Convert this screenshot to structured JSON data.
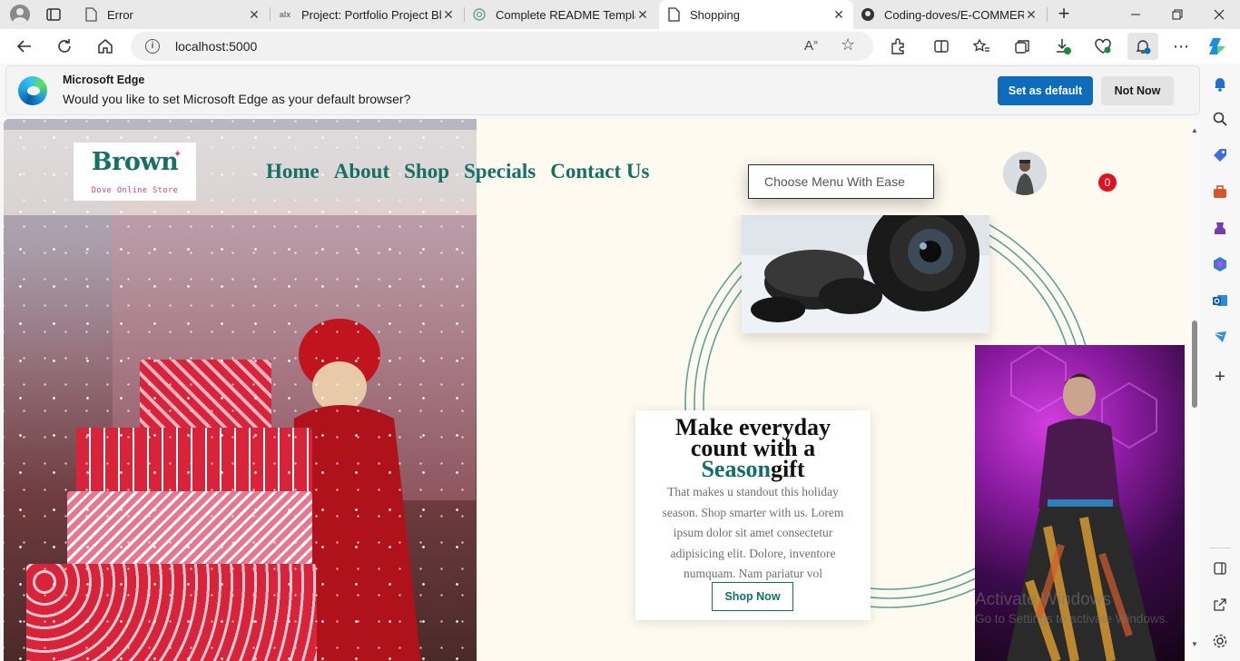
{
  "browser": {
    "tabs": [
      {
        "title": "Error",
        "favicon": "page-icon",
        "active": false
      },
      {
        "title": "Project: Portfolio Project Blo",
        "favicon": "alx-icon",
        "active": false
      },
      {
        "title": "Complete README Templat",
        "favicon": "openai-icon",
        "active": false
      },
      {
        "title": "Shopping",
        "favicon": "page-icon",
        "active": true
      },
      {
        "title": "Coding-doves/E-COMMERC",
        "favicon": "github-icon",
        "active": false
      }
    ],
    "url": "localhost:5000"
  },
  "infobar": {
    "title": "Microsoft Edge",
    "message": "Would you like to set Microsoft Edge as your default browser?",
    "primary_button": "Set as default",
    "secondary_button": "Not Now"
  },
  "site": {
    "logo": {
      "brand": "Brown",
      "tagline": "Dove Online Store"
    },
    "nav": [
      "Home",
      "About",
      "Shop",
      "Specials",
      "Contact Us"
    ],
    "menu_placeholder": "Choose Menu With Ease",
    "cart_count": "0"
  },
  "promo": {
    "title_line1": "Make everyday",
    "title_line2": "count with a",
    "title_accent": "Season",
    "title_end": "gift",
    "text": "That makes u standout this holiday season. Shop smarter with us. Lorem ipsum dolor sit amet consectetur adipisicing elit. Dolore, inventore numquam. Nam pariatur vol",
    "button": "Shop Now"
  },
  "watermark": {
    "line1": "Activate Windows",
    "line2": "Go to Settings to activate Windows."
  },
  "colors": {
    "brand_teal": "#157066",
    "edge_blue": "#0f6cbd",
    "badge_red": "#e0121f"
  }
}
